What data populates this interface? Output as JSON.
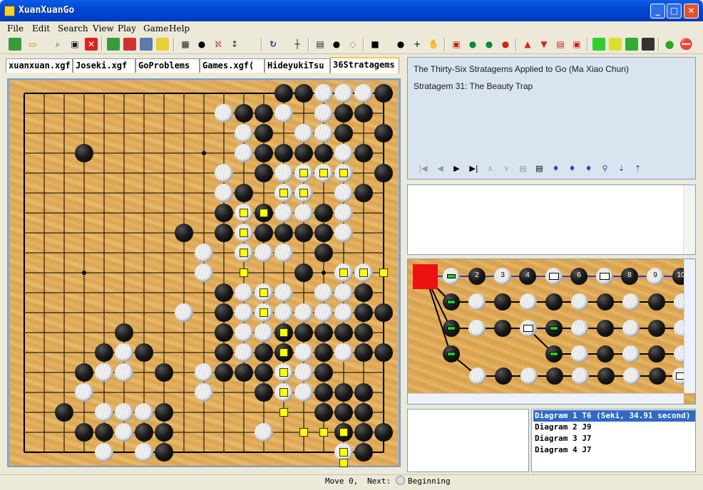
{
  "window": {
    "title": "XuanXuanGo",
    "minimize": "_",
    "maximize": "□",
    "close": "✕"
  },
  "menu": [
    "File",
    "Edit",
    "Search",
    "View",
    "Play",
    "Game",
    "Help"
  ],
  "tabs": [
    "xuanxuan.xgf",
    "Joseki.xgf",
    "GoProblems",
    "Games.xgf(",
    "HideyukiTsu",
    "36Stratagems"
  ],
  "info": {
    "line1": "The Thirty-Six Stratagems Applied to Go  (Ma Xiao Chun)",
    "line2": "Stratagem 31:  The Beauty Trap"
  },
  "tree": {
    "moves": [
      "2",
      "3",
      "4",
      "6",
      "8",
      "9",
      "10"
    ]
  },
  "variations": [
    "Diagram 1 T6 (Seki, 34.91 second)",
    "Diagram 2 J9",
    "Diagram 3 J7",
    "Diagram 4 J7"
  ],
  "status": {
    "move": "Move 0,",
    "next_label": "Next:",
    "position": "Beginning"
  },
  "board": {
    "size": 19,
    "black": [
      [
        13,
        0
      ],
      [
        14,
        0
      ],
      [
        18,
        0
      ],
      [
        11,
        1
      ],
      [
        12,
        1
      ],
      [
        16,
        1
      ],
      [
        17,
        1
      ],
      [
        12,
        2
      ],
      [
        16,
        2
      ],
      [
        18,
        2
      ],
      [
        12,
        3
      ],
      [
        13,
        3
      ],
      [
        14,
        3
      ],
      [
        15,
        3
      ],
      [
        17,
        3
      ],
      [
        3,
        3
      ],
      [
        12,
        4
      ],
      [
        18,
        4
      ],
      [
        11,
        5
      ],
      [
        17,
        5
      ],
      [
        10,
        6
      ],
      [
        12,
        6
      ],
      [
        15,
        6
      ],
      [
        10,
        7
      ],
      [
        8,
        7
      ],
      [
        12,
        7
      ],
      [
        13,
        7
      ],
      [
        14,
        7
      ],
      [
        15,
        7
      ],
      [
        15,
        8
      ],
      [
        14,
        9
      ],
      [
        10,
        10
      ],
      [
        17,
        10
      ],
      [
        10,
        11
      ],
      [
        17,
        11
      ],
      [
        18,
        11
      ],
      [
        10,
        12
      ],
      [
        13,
        12
      ],
      [
        14,
        12
      ],
      [
        15,
        12
      ],
      [
        16,
        12
      ],
      [
        17,
        12
      ],
      [
        5,
        12
      ],
      [
        10,
        13
      ],
      [
        4,
        13
      ],
      [
        6,
        13
      ],
      [
        12,
        13
      ],
      [
        13,
        13
      ],
      [
        15,
        13
      ],
      [
        17,
        13
      ],
      [
        18,
        13
      ],
      [
        3,
        14
      ],
      [
        7,
        14
      ],
      [
        10,
        14
      ],
      [
        11,
        14
      ],
      [
        12,
        14
      ],
      [
        12,
        15
      ],
      [
        15,
        14
      ],
      [
        12,
        15
      ],
      [
        15,
        15
      ],
      [
        16,
        15
      ],
      [
        17,
        15
      ],
      [
        2,
        16
      ],
      [
        7,
        16
      ],
      [
        15,
        16
      ],
      [
        16,
        16
      ],
      [
        17,
        16
      ],
      [
        16,
        17
      ],
      [
        3,
        17
      ],
      [
        4,
        17
      ],
      [
        6,
        17
      ],
      [
        7,
        17
      ],
      [
        17,
        17
      ],
      [
        18,
        17
      ],
      [
        7,
        18
      ],
      [
        17,
        18
      ]
    ],
    "white": [
      [
        15,
        0
      ],
      [
        16,
        0
      ],
      [
        17,
        0
      ],
      [
        10,
        1
      ],
      [
        13,
        1
      ],
      [
        15,
        1
      ],
      [
        11,
        2
      ],
      [
        14,
        2
      ],
      [
        15,
        2
      ],
      [
        11,
        3
      ],
      [
        16,
        3
      ],
      [
        10,
        4
      ],
      [
        13,
        4
      ],
      [
        14,
        4
      ],
      [
        15,
        4
      ],
      [
        16,
        4
      ],
      [
        10,
        5
      ],
      [
        13,
        5
      ],
      [
        14,
        5
      ],
      [
        16,
        5
      ],
      [
        11,
        6
      ],
      [
        13,
        6
      ],
      [
        14,
        6
      ],
      [
        16,
        6
      ],
      [
        11,
        7
      ],
      [
        16,
        7
      ],
      [
        9,
        8
      ],
      [
        11,
        8
      ],
      [
        12,
        8
      ],
      [
        13,
        8
      ],
      [
        9,
        9
      ],
      [
        16,
        9
      ],
      [
        17,
        9
      ],
      [
        11,
        10
      ],
      [
        12,
        10
      ],
      [
        13,
        10
      ],
      [
        15,
        10
      ],
      [
        16,
        10
      ],
      [
        11,
        11
      ],
      [
        12,
        11
      ],
      [
        13,
        11
      ],
      [
        14,
        11
      ],
      [
        15,
        11
      ],
      [
        16,
        11
      ],
      [
        8,
        11
      ],
      [
        11,
        12
      ],
      [
        12,
        12
      ],
      [
        5,
        13
      ],
      [
        11,
        13
      ],
      [
        14,
        13
      ],
      [
        16,
        13
      ],
      [
        4,
        14
      ],
      [
        5,
        14
      ],
      [
        9,
        14
      ],
      [
        13,
        14
      ],
      [
        14,
        14
      ],
      [
        3,
        15
      ],
      [
        9,
        15
      ],
      [
        13,
        15
      ],
      [
        14,
        15
      ],
      [
        4,
        16
      ],
      [
        5,
        16
      ],
      [
        6,
        16
      ],
      [
        16,
        16
      ],
      [
        17,
        16
      ],
      [
        5,
        17
      ],
      [
        12,
        17
      ],
      [
        16,
        17
      ],
      [
        4,
        18
      ],
      [
        6,
        18
      ],
      [
        16,
        18
      ]
    ],
    "marks": [
      [
        14,
        4
      ],
      [
        15,
        4
      ],
      [
        16,
        4
      ],
      [
        13,
        5
      ],
      [
        14,
        5
      ],
      [
        11,
        6
      ],
      [
        12,
        6
      ],
      [
        11,
        7
      ],
      [
        11,
        8
      ],
      [
        11,
        9
      ],
      [
        16,
        9
      ],
      [
        17,
        9
      ],
      [
        18,
        9
      ],
      [
        12,
        10
      ],
      [
        12,
        11
      ],
      [
        13,
        12
      ],
      [
        13,
        13
      ],
      [
        13,
        14
      ],
      [
        13,
        15
      ],
      [
        13,
        16
      ],
      [
        14,
        17
      ],
      [
        15,
        17
      ],
      [
        16,
        17
      ],
      [
        16,
        18
      ],
      [
        16,
        19
      ]
    ],
    "hoshi": [
      [
        3,
        3
      ],
      [
        9,
        3
      ],
      [
        15,
        3
      ],
      [
        3,
        9
      ],
      [
        9,
        9
      ],
      [
        15,
        9
      ],
      [
        3,
        15
      ],
      [
        9,
        15
      ],
      [
        15,
        15
      ]
    ]
  }
}
